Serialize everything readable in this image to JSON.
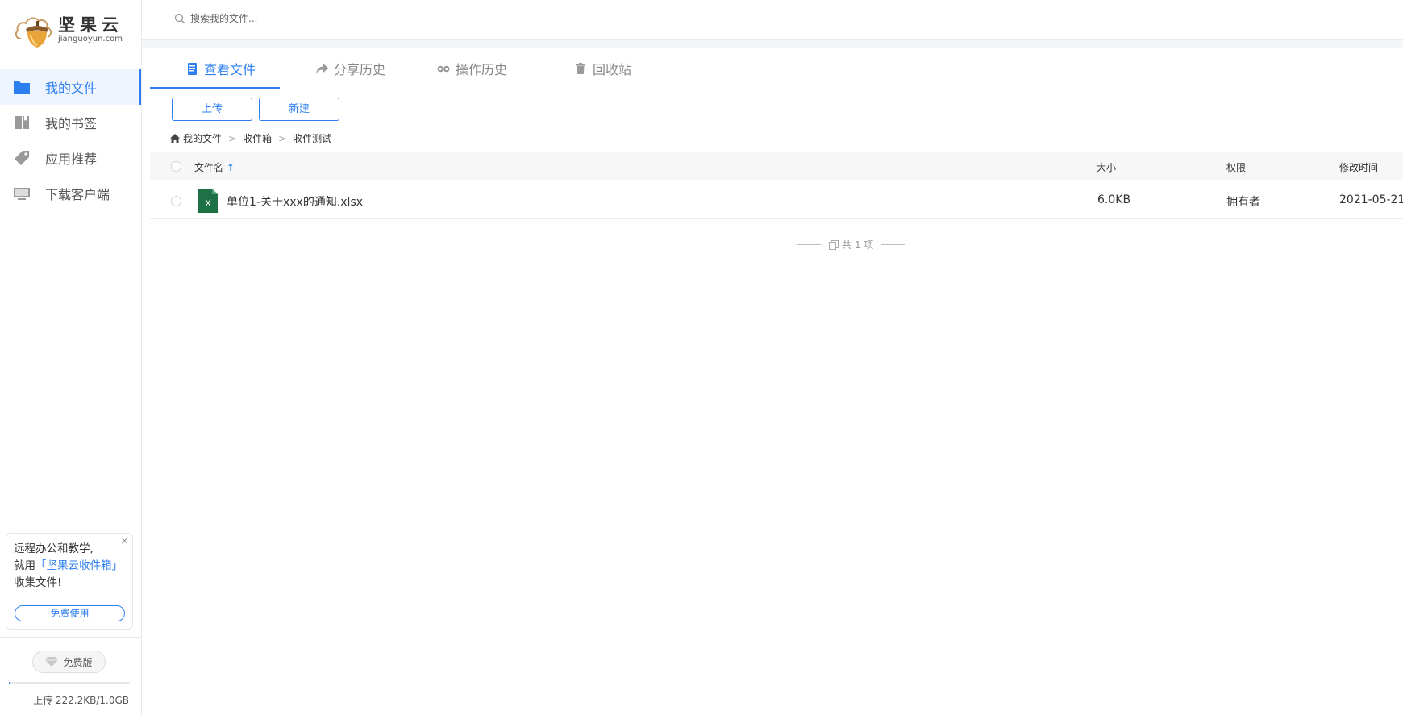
{
  "brand": {
    "name_cn": "坚果云",
    "name_en": "jianguoyun.com"
  },
  "colors": {
    "accent": "#2d7ff0",
    "excel": "#1e7145"
  },
  "sidebar": {
    "items": [
      {
        "label": "我的文件",
        "icon": "folder-icon",
        "active": true
      },
      {
        "label": "我的书签",
        "icon": "bookmark-icon",
        "active": false
      },
      {
        "label": "应用推荐",
        "icon": "tag-icon",
        "active": false
      },
      {
        "label": "下载客户端",
        "icon": "monitor-icon",
        "active": false
      }
    ],
    "promo": {
      "line1": "远程办公和教学,",
      "line2_prefix": "就用",
      "line2_highlight": "「坚果云收件箱」",
      "line3": "收集文件!",
      "button": "免费使用",
      "close": "×"
    },
    "plan": "免费版",
    "quota_text": "上传 222.2KB/1.0GB",
    "quota_fraction": 0.0002
  },
  "search": {
    "placeholder": "搜索我的文件..."
  },
  "tabs": [
    {
      "label": "查看文件",
      "icon": "file-list-icon",
      "active": true
    },
    {
      "label": "分享历史",
      "icon": "share-icon",
      "active": false
    },
    {
      "label": "操作历史",
      "icon": "history-icon",
      "active": false
    },
    {
      "label": "回收站",
      "icon": "trash-icon",
      "active": false
    }
  ],
  "toolbar": {
    "upload": "上传",
    "create": "新建"
  },
  "breadcrumb": [
    "我的文件",
    "收件箱",
    "收件测试"
  ],
  "table": {
    "columns": {
      "name": "文件名",
      "name_sort": "↑",
      "size": "大小",
      "permission": "权限",
      "modified": "修改时间"
    },
    "rows": [
      {
        "name": "单位1-关于xxx的通知.xlsx",
        "size": "6.0KB",
        "permission": "拥有者",
        "modified": "2021-05-21 ",
        "icon": "excel-file-icon"
      }
    ],
    "total": "共 1 项"
  }
}
